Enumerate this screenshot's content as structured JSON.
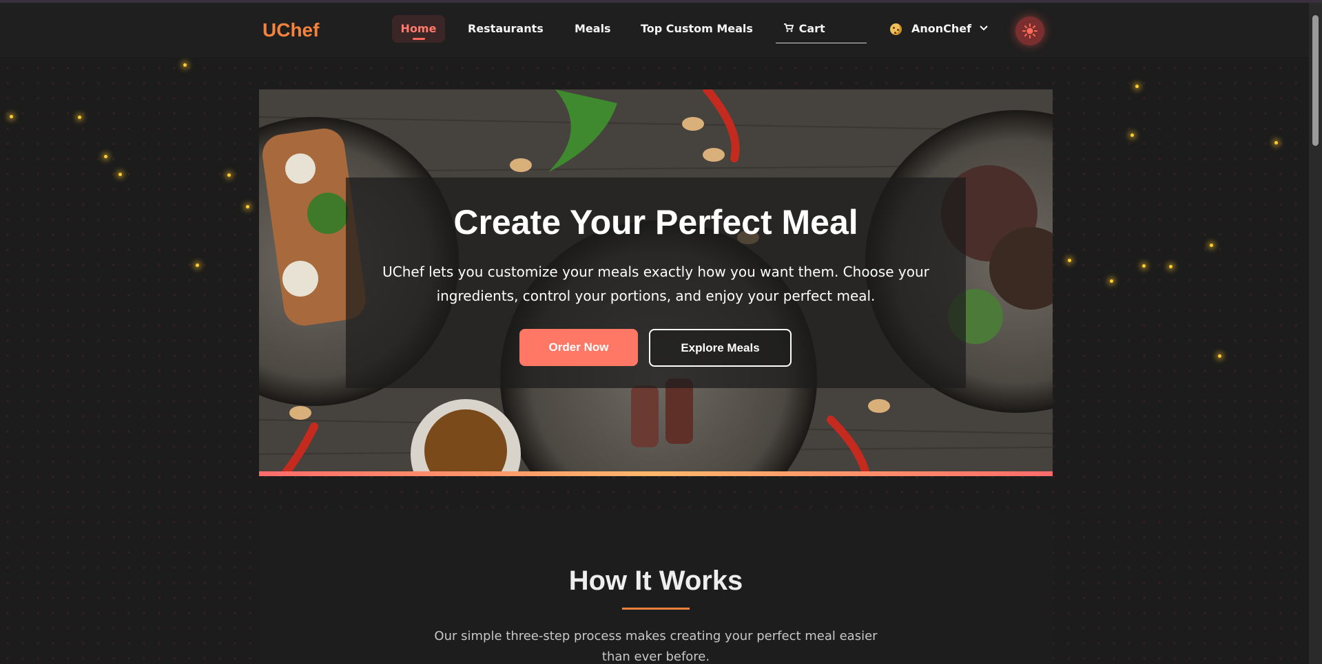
{
  "brand": {
    "name": "UChef",
    "color": "#f4823c"
  },
  "nav": {
    "items": [
      {
        "label": "Home",
        "active": true
      },
      {
        "label": "Restaurants"
      },
      {
        "label": "Meals"
      },
      {
        "label": "Top Custom Meals"
      },
      {
        "label": "Cart",
        "icon": "cart-icon"
      }
    ],
    "user": {
      "name": "AnonChef",
      "icon": "cookie-icon"
    },
    "theme_toggle_icon": "sun-icon"
  },
  "hero": {
    "title": "Create Your Perfect Meal",
    "text": "UChef lets you customize your meals exactly how you want them. Choose your ingredients, control your portions, and enjoy your perfect meal.",
    "primary_button": "Order Now",
    "secondary_button": "Explore Meals"
  },
  "how_it_works": {
    "title": "How It Works",
    "text": "Our simple three-step process makes creating your perfect meal easier than ever before."
  },
  "colors": {
    "accent": "#ff7866",
    "background": "#1c1c1c",
    "brand_orange": "#f4823c"
  }
}
